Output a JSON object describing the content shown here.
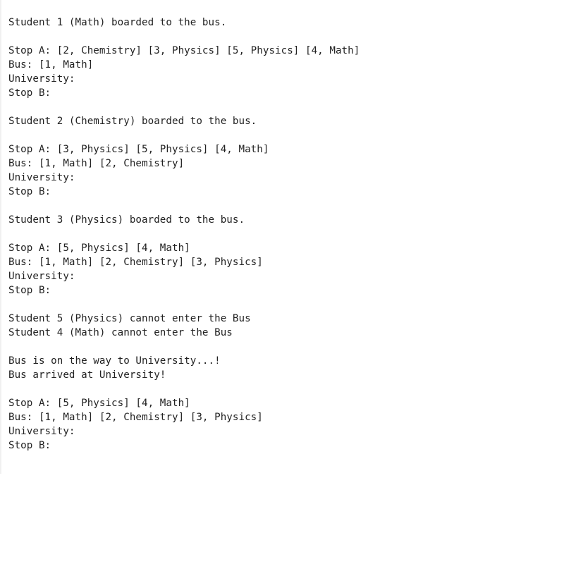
{
  "console": {
    "lines": [
      "Student 1 (Math) boarded to the bus.",
      "",
      "Stop A: [2, Chemistry] [3, Physics] [5, Physics] [4, Math]",
      "Bus: [1, Math]",
      "University:",
      "Stop B:",
      "",
      "Student 2 (Chemistry) boarded to the bus.",
      "",
      "Stop A: [3, Physics] [5, Physics] [4, Math]",
      "Bus: [1, Math] [2, Chemistry]",
      "University:",
      "Stop B:",
      "",
      "Student 3 (Physics) boarded to the bus.",
      "",
      "Stop A: [5, Physics] [4, Math]",
      "Bus: [1, Math] [2, Chemistry] [3, Physics]",
      "University:",
      "Stop B:",
      "",
      "Student 5 (Physics) cannot enter the Bus",
      "Student 4 (Math) cannot enter the Bus",
      "",
      "Bus is on the way to University...!",
      "Bus arrived at University!",
      "",
      "Stop A: [5, Physics] [4, Math]",
      "Bus: [1, Math] [2, Chemistry] [3, Physics]",
      "University:",
      "Stop B:"
    ]
  }
}
